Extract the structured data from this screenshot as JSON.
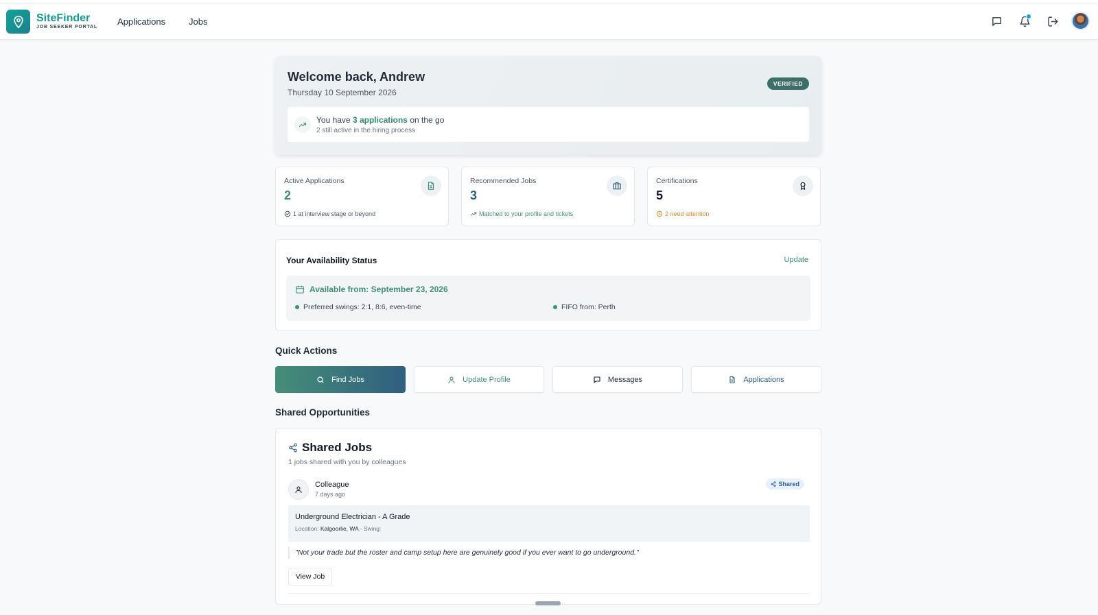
{
  "brand": {
    "name": "SiteFinder",
    "subtitle": "JOB SEEKER PORTAL",
    "color": "#149c8f"
  },
  "nav": {
    "items": [
      {
        "label": "Applications"
      },
      {
        "label": "Jobs"
      }
    ]
  },
  "header_icons": [
    "message-icon",
    "bell-icon",
    "logout-icon",
    "avatar"
  ],
  "welcome": {
    "greeting": "Welcome back, Andrew",
    "date": "Thursday 10 September 2026",
    "badge": "VERIFIED",
    "summary_prefix": "You have",
    "summary_highlight": "3 applications",
    "summary_suffix": "on the go",
    "summary_sub": "2 still active in the hiring process"
  },
  "stats": [
    {
      "label": "Active Applications",
      "value": "2",
      "sub": "1 at interview stage or beyond",
      "value_color": "#3f8f75",
      "sub_color": "#4b5563",
      "icon": "document-icon"
    },
    {
      "label": "Recommended Jobs",
      "value": "3",
      "sub": "Matched to your profile and tickets",
      "value_color": "#2f5f80",
      "sub_color": "#3f8f75",
      "icon": "briefcase-icon"
    },
    {
      "label": "Certifications",
      "value": "5",
      "sub": "2 need attention",
      "value_color": "#111827",
      "sub_color": "#e08a2c",
      "icon": "award-icon"
    }
  ],
  "availability": {
    "title": "Your Availability Status",
    "update_label": "Update",
    "available_from": "Available from: September 23, 2026",
    "preferred_swings": "Preferred swings: 2:1, 8:6, even-time",
    "fifo": "FIFO from: Perth"
  },
  "quick_actions": {
    "title": "Quick Actions",
    "items": [
      {
        "label": "Find Jobs",
        "icon": "search-icon"
      },
      {
        "label": "Update Profile",
        "icon": "user-icon"
      },
      {
        "label": "Messages",
        "icon": "message-icon"
      },
      {
        "label": "Applications",
        "icon": "document-icon"
      }
    ]
  },
  "shared_section": {
    "title": "Shared Opportunities",
    "card_title": "Shared Jobs",
    "description": "1 jobs shared with you by colleagues",
    "item": {
      "from": "Colleague",
      "time": "7 days ago",
      "badge": "Shared",
      "job_title": "Underground Electrician - A Grade",
      "location_label": "Location:",
      "location": "Kalgoorlie, WA",
      "swing_label": "- Swing:",
      "quote": "\"Not your trade but the roster and camp setup here are genuinely good if you ever want to go underground.\"",
      "view_label": "View Job"
    }
  }
}
